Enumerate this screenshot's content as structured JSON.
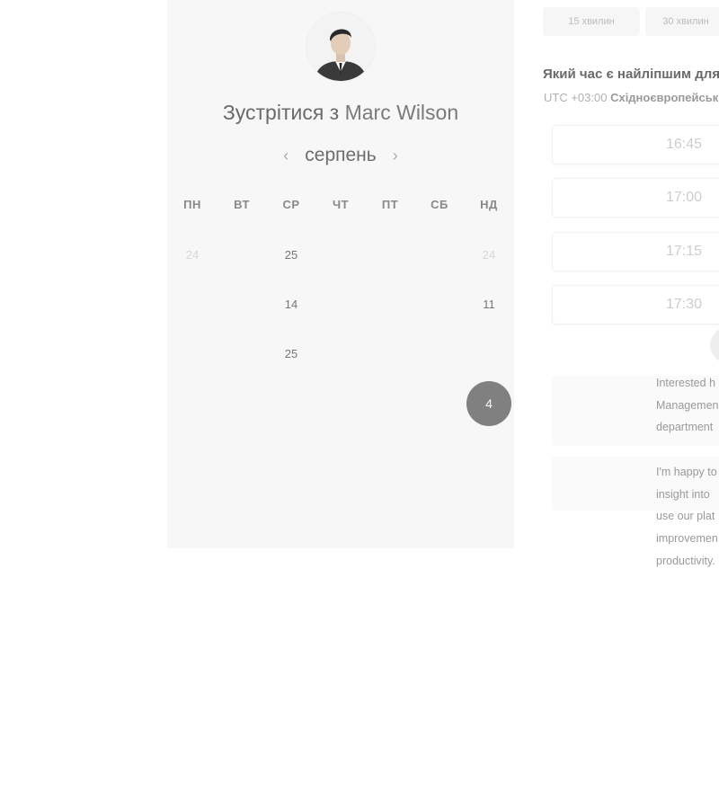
{
  "calendar": {
    "title_prefix": "Зустрітися з",
    "host_name": "Marc Wilson",
    "month": "серпень",
    "prev_icon": "‹",
    "next_icon": "›",
    "weekdays": [
      "ПН",
      "ВТ",
      "СР",
      "ЧТ",
      "ПТ",
      "СБ",
      "НД"
    ],
    "weeks": [
      [
        "24",
        "",
        "25",
        "",
        "",
        "",
        "24"
      ],
      [
        "",
        "",
        "14",
        "",
        "",
        "",
        "11"
      ],
      [
        "",
        "",
        "25",
        "",
        "",
        "",
        ""
      ],
      [
        "",
        "",
        "",
        "",
        "",
        "",
        "4"
      ],
      [
        "",
        "",
        "",
        "",
        "",
        "",
        ""
      ]
    ],
    "available_days": [
      "14",
      "11",
      "25"
    ],
    "selected_day": "4"
  },
  "booking": {
    "durations": [
      "15 хвилин",
      "30 хвилин"
    ],
    "question": "Який час є найліпшим для",
    "timezone_offset": "UTC +03:00",
    "timezone_name": "Східноєвропейський",
    "slots": [
      "16:45",
      "17:00",
      "17:15",
      "17:30"
    ],
    "message_paragraph_1": [
      "Interested h",
      "Managemen",
      "department"
    ],
    "message_paragraph_2": [
      "I'm happy to",
      "insight into",
      "use our plat",
      "improvemen",
      "productivity."
    ]
  },
  "colors": {
    "selected_day_bg": "#808080",
    "panel_bg": "#f7f7f7"
  }
}
